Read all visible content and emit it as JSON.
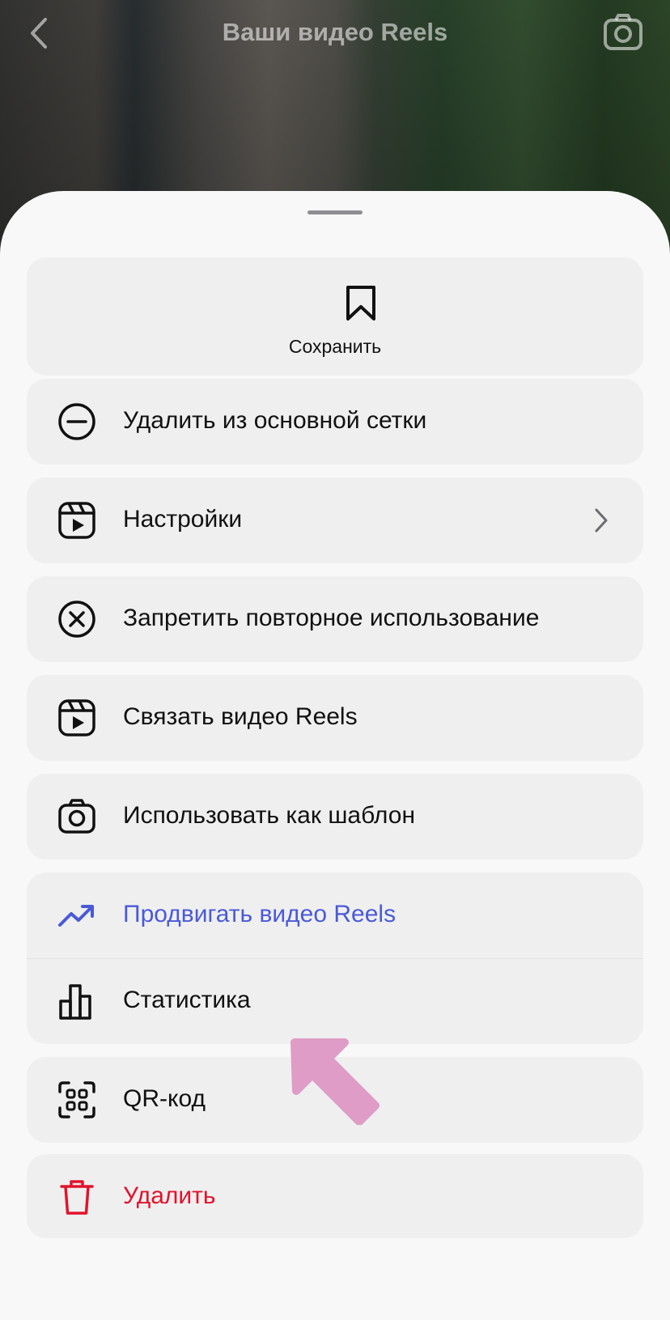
{
  "header": {
    "title": "Ваши видео Reels",
    "back_icon": "chevron-left-icon",
    "camera_icon": "camera-icon"
  },
  "sheet": {
    "save": {
      "label": "Сохранить",
      "icon": "bookmark-icon"
    },
    "items": [
      {
        "label": "Удалить из основной сетки",
        "icon": "minus-circle-icon"
      },
      {
        "label": "Настройки",
        "icon": "reels-icon",
        "has_chevron": true
      },
      {
        "label": "Запретить повторное использование",
        "icon": "x-circle-icon"
      },
      {
        "label": "Связать видео Reels",
        "icon": "reels-icon"
      },
      {
        "label": "Использовать как шаблон",
        "icon": "camera-icon"
      }
    ],
    "group": [
      {
        "label": "Продвигать видео Reels",
        "icon": "trending-up-icon"
      },
      {
        "label": "Статистика",
        "icon": "bar-chart-icon"
      }
    ],
    "qr": {
      "label": "QR-код",
      "icon": "qr-code-icon"
    },
    "delete": {
      "label": "Удалить",
      "icon": "trash-icon"
    }
  },
  "colors": {
    "promo": "#4a5ad6",
    "danger": "#e0142b",
    "annotation_arrow": "#de9cc6"
  }
}
